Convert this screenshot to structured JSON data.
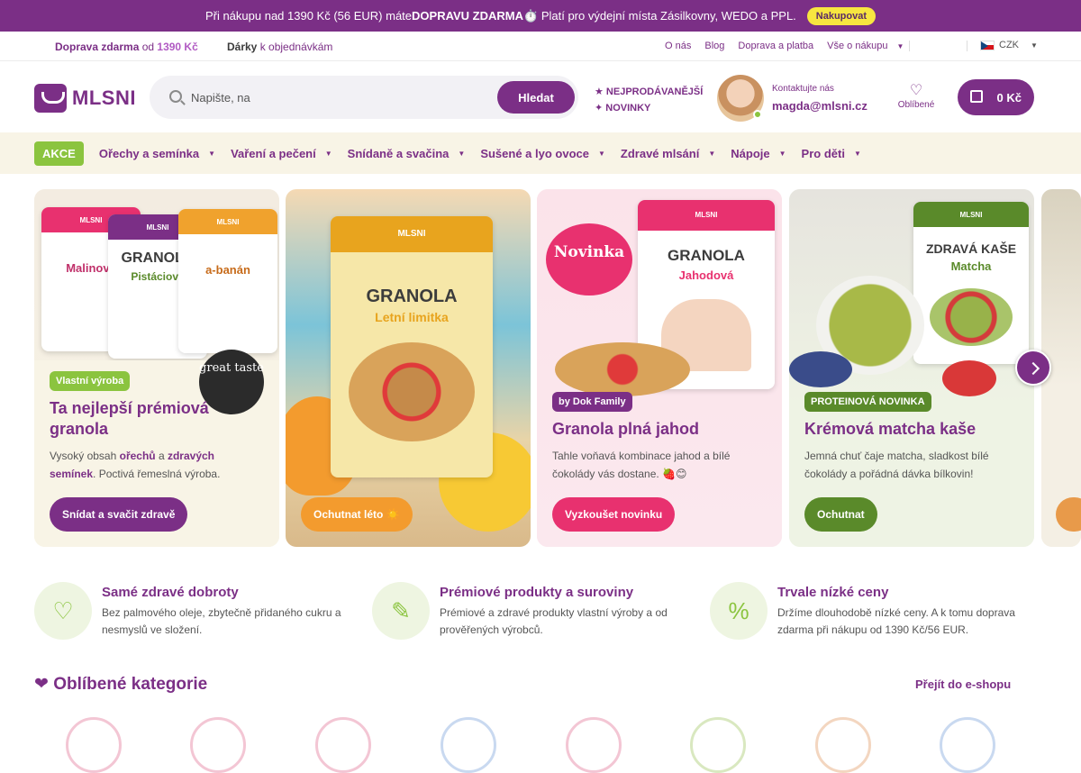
{
  "promo": {
    "text_before": "Při nákupu nad 1390 Kč (56 EUR) máte ",
    "highlight": "DOPRAVU ZDARMA",
    "text_after": " ⏱️ Platí pro výdejní místa Zásilkovny, WEDO a PPL.",
    "button": "Nakupovat"
  },
  "utility": {
    "ship_bold": "Doprava zdarma",
    "ship_mid": " od ",
    "ship_amount": "1390 Kč",
    "gifts_bold": "Dárky",
    "gifts_rest": " k objednávkám",
    "links": [
      "O nás",
      "Blog",
      "Doprava a platba",
      "Vše o nákupu"
    ],
    "currency": "CZK"
  },
  "header": {
    "logo": "MLSNI",
    "search_placeholder": "Napište, na",
    "search_button": "Hledat",
    "quick": [
      "NEJPRODÁVANĚJŠÍ",
      "NOVINKY"
    ],
    "contact_label": "Kontaktujte nás",
    "contact_email": "magda@mlsni.cz",
    "favorites": "Oblíbené",
    "cart_total": "0 Kč"
  },
  "nav": {
    "akce": "AKCE",
    "items": [
      "Ořechy a semínka",
      "Vaření a pečení",
      "Snídaně a svačina",
      "Sušené a lyo ovoce",
      "Zdravé mlsání",
      "Nápoje",
      "Pro děti"
    ]
  },
  "slides": [
    {
      "tag": "Vlastní výroba",
      "title": "Ta nejlepší prémiová granola",
      "desc_1": "Vysoký obsah ",
      "desc_b1": "ořechů",
      "desc_2": " a ",
      "desc_b2": "zdravých semínek",
      "desc_3": ". Poctivá řemeslná výroba.",
      "cta": "Snídat a svačit zdravě",
      "badge": "great taste",
      "pack_names": [
        "Malinová",
        "Pistáciová",
        "a-banán"
      ]
    },
    {
      "pack_title": "GRANOLA",
      "pack_sub": "Letní limitka",
      "cta": "Ochutnat léto ☀️"
    },
    {
      "sticker": "Novinka",
      "tag": "by Dok Family",
      "title": "Granola plná jahod",
      "desc": "Tahle voňavá kombinace jahod a bílé čokolády vás dostane. 🍓😊",
      "cta": "Vyzkoušet novinku",
      "pack_title": "GRANOLA",
      "pack_sub": "Jahodová"
    },
    {
      "tag": "PROTEINOVÁ NOVINKA",
      "title": "Krémová matcha kaše",
      "desc": "Jemná chuť čaje matcha, sladkost bílé čokolády a pořádná dávka bílkovin!",
      "cta": "Ochutnat",
      "pack_title": "ZDRAVÁ KAŠE",
      "pack_sub": "Matcha"
    }
  ],
  "features": [
    {
      "title": "Samé zdravé dobroty",
      "text": "Bez palmového oleje, zbytečně přidaného cukru a nesmyslů ve složení.",
      "icon": "heart-leaf-icon"
    },
    {
      "title": "Prémiové produkty a suroviny",
      "text": "Prémiové a zdravé produkty vlastní výroby a od prověřených výrobců.",
      "icon": "premium-ribbon-icon"
    },
    {
      "title": "Trvale nízké ceny",
      "text": "Držíme dlouhodobě nízké ceny. A k tomu doprava zdarma při nákupu od 1390 Kč/56 EUR.",
      "icon": "price-tag-icon"
    }
  ],
  "categories": {
    "heading": "Oblíbené kategorie",
    "link": "Přejít do e-shopu"
  },
  "colors": {
    "brand": "#7b2f86",
    "accent": "#8bc43f",
    "pink": "#e8316f",
    "promo_button": "#f7e640"
  }
}
